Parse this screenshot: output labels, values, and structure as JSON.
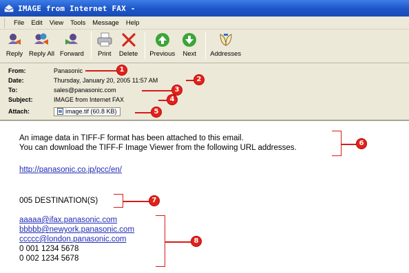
{
  "window": {
    "title": "IMAGE from Internet FAX -"
  },
  "menubar": {
    "items": [
      "File",
      "Edit",
      "View",
      "Tools",
      "Message",
      "Help"
    ]
  },
  "toolbar": {
    "buttons": [
      {
        "label": "Reply",
        "icon": "reply-icon"
      },
      {
        "label": "Reply All",
        "icon": "reply-all-icon"
      },
      {
        "label": "Forward",
        "icon": "forward-icon"
      },
      {
        "label": "Print",
        "icon": "print-icon"
      },
      {
        "label": "Delete",
        "icon": "delete-icon"
      },
      {
        "label": "Previous",
        "icon": "previous-icon"
      },
      {
        "label": "Next",
        "icon": "next-icon"
      },
      {
        "label": "Addresses",
        "icon": "addresses-icon"
      }
    ]
  },
  "header": {
    "from_label": "From:",
    "from_value": "Panasonic",
    "date_label": "Date:",
    "date_value": "Thursday, January 20, 2005 11:57 AM",
    "to_label": "To:",
    "to_value": "sales@panasonic.com",
    "subject_label": "Subject:",
    "subject_value": "IMAGE from Internet FAX",
    "attach_label": "Attach:",
    "attach_value": "image.tif (60.8 KB)"
  },
  "callouts": {
    "n1": "1",
    "n2": "2",
    "n3": "3",
    "n4": "4",
    "n5": "5",
    "n6": "6",
    "n7": "7",
    "n8": "8"
  },
  "body": {
    "line1": "An image data in TIFF-F format has been attached to this email.",
    "line2": "You can download the TIFF-F Image Viewer from the following URL addresses.",
    "url": "http://panasonic.co.jp/pcc/en/",
    "destinations": "005 DESTINATION(S)",
    "addresses": [
      "aaaaa@ifax.panasonic.com",
      "bbbbb@newyork.panasonic.com",
      "ccccc@london.panasonic.com"
    ],
    "numbers": [
      "0 001 1234 5678",
      "0 002 1234 5678"
    ]
  },
  "colors": {
    "callout_red": "#e3201b",
    "link_blue": "#1f2bb3",
    "titlebar_blue": "#1d55c8",
    "chrome_beige": "#ece9d8"
  }
}
